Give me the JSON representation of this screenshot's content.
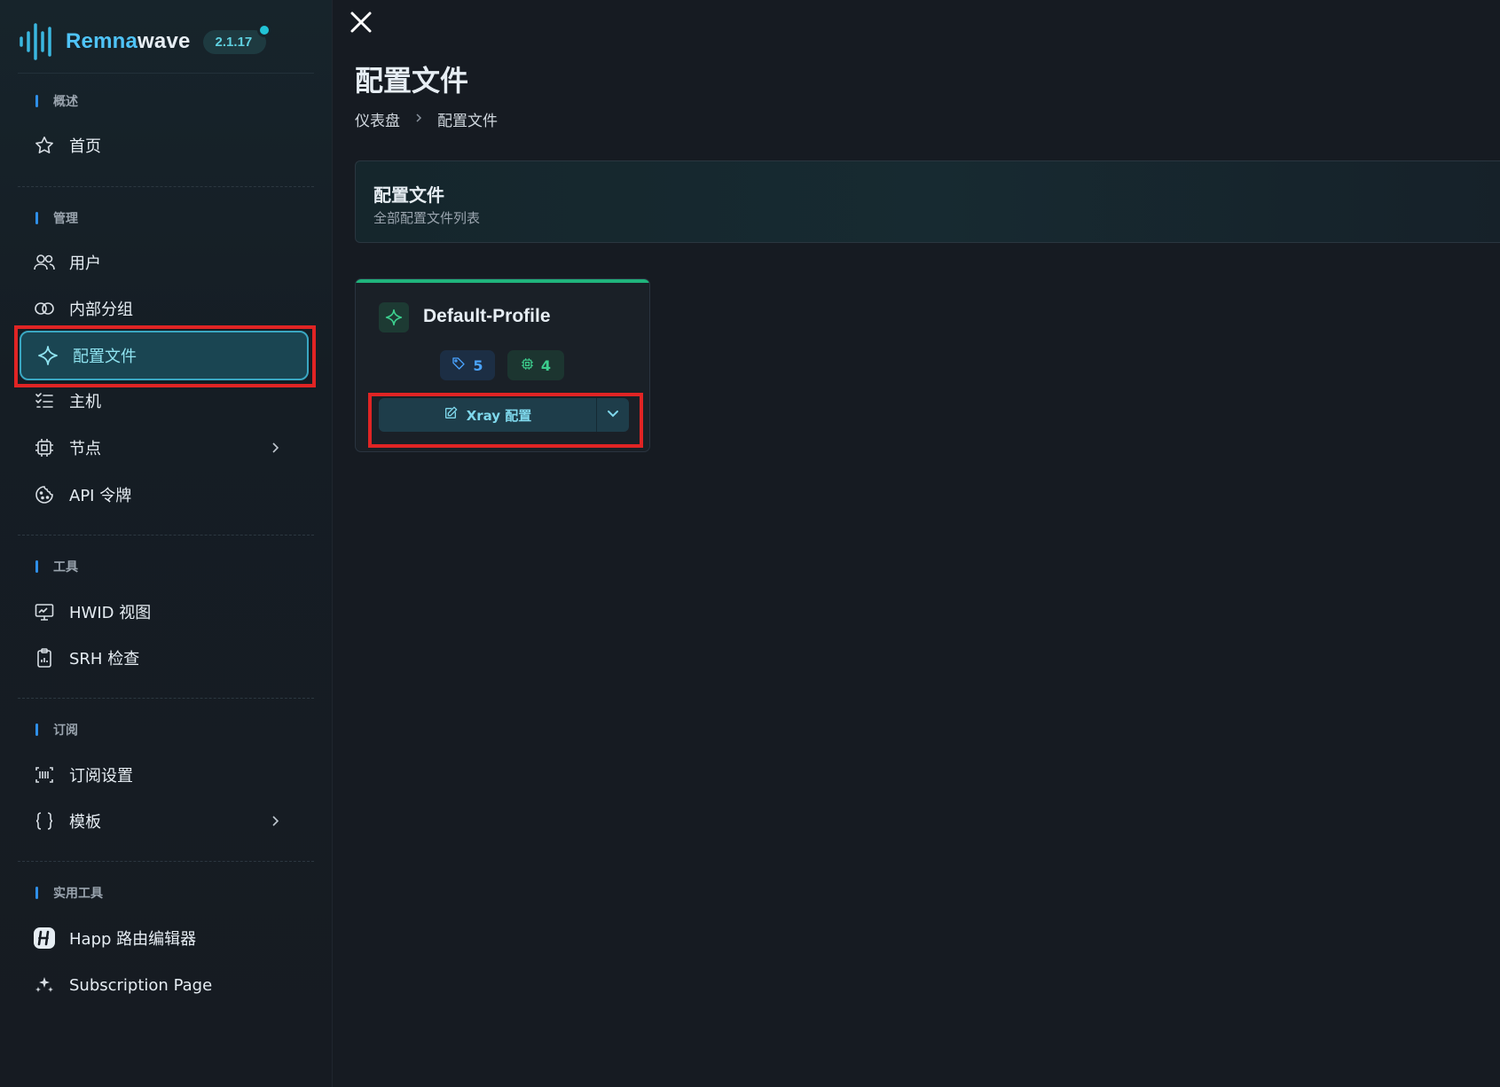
{
  "brand": {
    "name_part1": "Remna",
    "name_part2": "wave",
    "version": "2.1.17"
  },
  "sidebar": {
    "sections": [
      {
        "label": "概述"
      },
      {
        "label": "管理"
      },
      {
        "label": "工具"
      },
      {
        "label": "订阅"
      },
      {
        "label": "实用工具"
      }
    ],
    "items": [
      {
        "label": "首页",
        "icon": "star-icon"
      },
      {
        "label": "用户",
        "icon": "users-icon"
      },
      {
        "label": "内部分组",
        "icon": "link-circles-icon"
      },
      {
        "label": "配置文件",
        "icon": "sparkle-icon",
        "active": true
      },
      {
        "label": "主机",
        "icon": "list-check-icon"
      },
      {
        "label": "节点",
        "icon": "cpu-icon"
      },
      {
        "label": "API 令牌",
        "icon": "cookie-icon"
      },
      {
        "label": "HWID 视图",
        "icon": "monitor-icon"
      },
      {
        "label": "SRH 检查",
        "icon": "clipboard-icon"
      },
      {
        "label": "订阅设置",
        "icon": "barcode-icon"
      },
      {
        "label": "模板",
        "icon": "braces-icon"
      },
      {
        "label": "Happ 路由编辑器",
        "icon": "happ-logo-icon"
      },
      {
        "label": "Subscription Page",
        "icon": "sparkles-icon"
      }
    ]
  },
  "page": {
    "title": "配置文件",
    "breadcrumb": [
      "仪表盘",
      "配置文件"
    ]
  },
  "header_card": {
    "title": "配置文件",
    "subtitle": "全部配置文件列表"
  },
  "profile": {
    "name": "Default-Profile",
    "tags_count": "5",
    "inbounds_count": "4",
    "button_label": "Xray 配置"
  },
  "colors": {
    "accent": "#4fc3f7",
    "active_bg": "#1a4552",
    "success": "#20b47c",
    "highlight": "#e02424"
  }
}
